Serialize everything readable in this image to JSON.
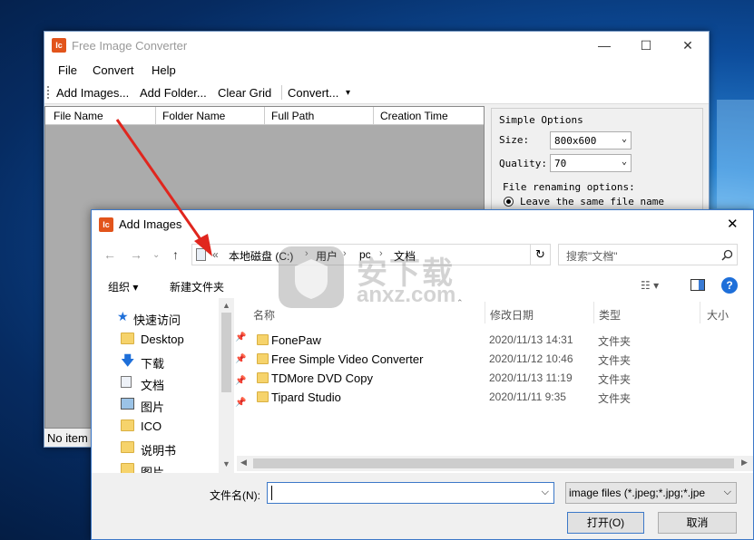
{
  "main_window": {
    "icon_text": "Ic",
    "title": "Free Image Converter",
    "minimize": "—",
    "maximize": "☐",
    "close": "✕",
    "menu": [
      "File",
      "Convert",
      "Help"
    ],
    "toolbar": {
      "add_images": "Add Images...",
      "add_folder": "Add Folder...",
      "clear_grid": "Clear Grid",
      "convert": "Convert...",
      "dropdown": "▾"
    },
    "grid_columns": [
      "File Name",
      "Folder Name",
      "Full Path",
      "Creation Time"
    ],
    "status": "No item",
    "options": {
      "title": "Simple Options",
      "size_label": "Size:",
      "size_value": "800x600",
      "quality_label": "Quality:",
      "quality_value": "70",
      "renaming_label": "File renaming options:",
      "rename_option_1": "Leave the same file name"
    }
  },
  "dialog": {
    "icon_text": "Ic",
    "title": "Add Images",
    "close": "✕",
    "nav": {
      "back": "←",
      "forward": "→",
      "up": "↑",
      "chevron": "«"
    },
    "breadcrumbs": [
      "本地磁盘 (C:)",
      "用户",
      "pc",
      "文档"
    ],
    "crumb_sep": "›",
    "address_dropdown": "⌵",
    "refresh": "↻",
    "search_placeholder": "搜索\"文档\"",
    "commands": {
      "organize": "组织 ▾",
      "new_folder": "新建文件夹",
      "view": "☷ ▾",
      "help": "?"
    },
    "quick_access": "快速访问",
    "nav_items": [
      "Desktop",
      "下载",
      "文档",
      "图片",
      "ICO",
      "说明书",
      "图片"
    ],
    "list_headers": {
      "name": "名称",
      "date": "修改日期",
      "type": "类型",
      "size": "大小"
    },
    "files": [
      {
        "name": "FonePaw",
        "date": "2020/11/13 14:31",
        "type": "文件夹"
      },
      {
        "name": "Free Simple Video Converter",
        "date": "2020/11/12 10:46",
        "type": "文件夹"
      },
      {
        "name": "TDMore DVD Copy",
        "date": "2020/11/13 11:19",
        "type": "文件夹"
      },
      {
        "name": "Tipard Studio",
        "date": "2020/11/11 9:35",
        "type": "文件夹"
      }
    ],
    "filename_label": "文件名(N):",
    "filename_value": "",
    "filter_value": "image files (*.jpeg;*.jpg;*.jpe",
    "open_button": "打开(O)",
    "cancel_button": "取消"
  },
  "watermark": {
    "text_cn": "安下载",
    "text_en": "anxz.com"
  },
  "colors": {
    "arrow": "#e0261e",
    "app_icon": "#e2541b",
    "folder": "#f6d36b",
    "dialog_border": "#3c78c8"
  }
}
